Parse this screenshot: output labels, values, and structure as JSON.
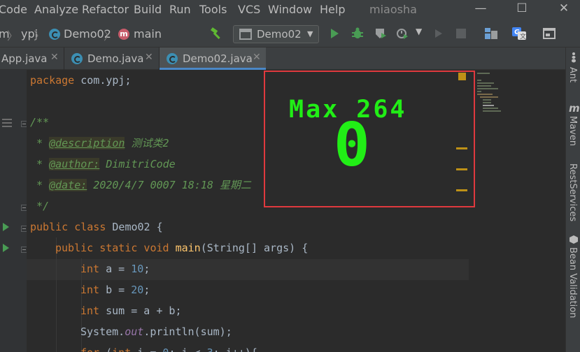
{
  "menu": {
    "items": [
      "Code",
      "Analyze",
      "Refactor",
      "Build",
      "Run",
      "Tools",
      "VCS",
      "Window",
      "Help"
    ],
    "project_title": "miaosha"
  },
  "window_controls": {
    "minimize": "—",
    "maximize": "☐",
    "close": "✕"
  },
  "breadcrumb": {
    "module": "m",
    "package": "ypj",
    "class": "Demo02",
    "method_icon": "m",
    "method": "main",
    "sep": "〉"
  },
  "toolbar": {
    "run_config": "Demo02",
    "icons": [
      "build-hammer-icon",
      "run-icon",
      "debug-icon",
      "coverage-icon",
      "profile-icon",
      "stop-icon",
      "project-structure-icon",
      "translate-icon",
      "terminal-icon"
    ]
  },
  "tabs": [
    {
      "label": "App.java",
      "active": false
    },
    {
      "label": "Demo.java",
      "active": false
    },
    {
      "label": "Demo02.java",
      "active": true
    }
  ],
  "code": {
    "l1": {
      "kw": "package",
      "rest": " com.ypj;"
    },
    "l2": {
      "text": "/**"
    },
    "l3": {
      "pre": " * ",
      "tag": "@description",
      "text": " 测试类2"
    },
    "l4": {
      "pre": " * ",
      "tag": "@author:",
      "text": " DimitriCode"
    },
    "l5": {
      "pre": " * ",
      "tag": "@date:",
      "text": " 2020/4/7 0007 18:18 星期二"
    },
    "l6": {
      "text": " */"
    },
    "l7": {
      "kw": "public class",
      "rest": " Demo02 {"
    },
    "l8": {
      "kw": "public static void",
      "sp": " ",
      "meth": "main",
      "rest": "(String[] args) {"
    },
    "l9": {
      "kw": "int",
      "rest": " a = ",
      "num": "10",
      "end": ";"
    },
    "l10": {
      "kw": "int",
      "rest": " b = ",
      "num": "20",
      "end": ";"
    },
    "l11": {
      "kw": "int",
      "rest": " sum = a + b;"
    },
    "l12": {
      "pre": "System.",
      "field": "out",
      "rest": ".println(sum);"
    },
    "l13": {
      "kw": "for",
      "rest": " (",
      "kw2": "int",
      "rest2": " i = ",
      "num": "0",
      "rest3": "; i < ",
      "num2": "3",
      "end": "; i++){"
    }
  },
  "game": {
    "title": "Max 264",
    "score": "0",
    "color": "#21ee16"
  },
  "right_tools": [
    "Ant",
    "Maven",
    "RestServices",
    "Bean Validation"
  ]
}
